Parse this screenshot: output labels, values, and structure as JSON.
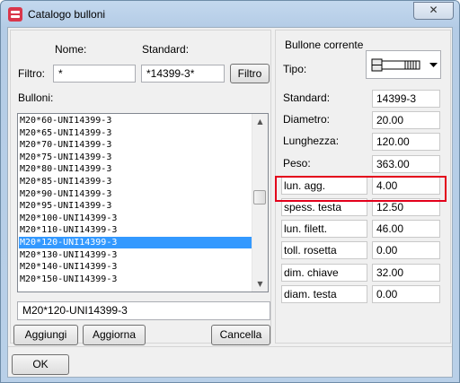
{
  "window": {
    "title": "Catalogo bulloni",
    "close_glyph": "✕",
    "close_icon": "close-icon"
  },
  "search": {
    "name_label": "Nome:",
    "standard_label": "Standard:",
    "filter_label": "Filtro:",
    "name_value": "*",
    "standard_value": "*14399-3*",
    "filter_button": "Filtro"
  },
  "bolts": {
    "label": "Bulloni:",
    "items": [
      "M20*60-UNI14399-3",
      "M20*65-UNI14399-3",
      "M20*70-UNI14399-3",
      "M20*75-UNI14399-3",
      "M20*80-UNI14399-3",
      "M20*85-UNI14399-3",
      "M20*90-UNI14399-3",
      "M20*95-UNI14399-3",
      "M20*100-UNI14399-3",
      "M20*110-UNI14399-3",
      "M20*120-UNI14399-3",
      "M20*130-UNI14399-3",
      "M20*140-UNI14399-3",
      "M20*150-UNI14399-3"
    ],
    "selected_index": 10,
    "name_field": "M20*120-UNI14399-3",
    "add_button": "Aggiungi",
    "update_button": "Aggiorna",
    "delete_button": "Cancella"
  },
  "current": {
    "group_label": "Bullone corrente",
    "type_label": "Tipo:",
    "type_icon": "bolt-icon",
    "fields": [
      {
        "label": "Standard:",
        "value": "14399-3",
        "boxed": false
      },
      {
        "label": "Diametro:",
        "value": "20.00",
        "boxed": false
      },
      {
        "label": "Lunghezza:",
        "value": "120.00",
        "boxed": false
      },
      {
        "label": "Peso:",
        "value": "363.00",
        "boxed": false
      },
      {
        "label": "lun. agg.",
        "value": "4.00",
        "boxed": true
      },
      {
        "label": "spess. testa",
        "value": "12.50",
        "boxed": true
      },
      {
        "label": "lun. filett.",
        "value": "46.00",
        "boxed": true
      },
      {
        "label": "toll. rosetta",
        "value": "0.00",
        "boxed": true
      },
      {
        "label": "dim. chiave",
        "value": "32.00",
        "boxed": true
      },
      {
        "label": "diam. testa",
        "value": "0.00",
        "boxed": true
      }
    ]
  },
  "footer": {
    "ok_button": "OK"
  },
  "colors": {
    "selection": "#3399ff",
    "highlight": "#e3001b",
    "window_frame": "#b9d0e8"
  }
}
